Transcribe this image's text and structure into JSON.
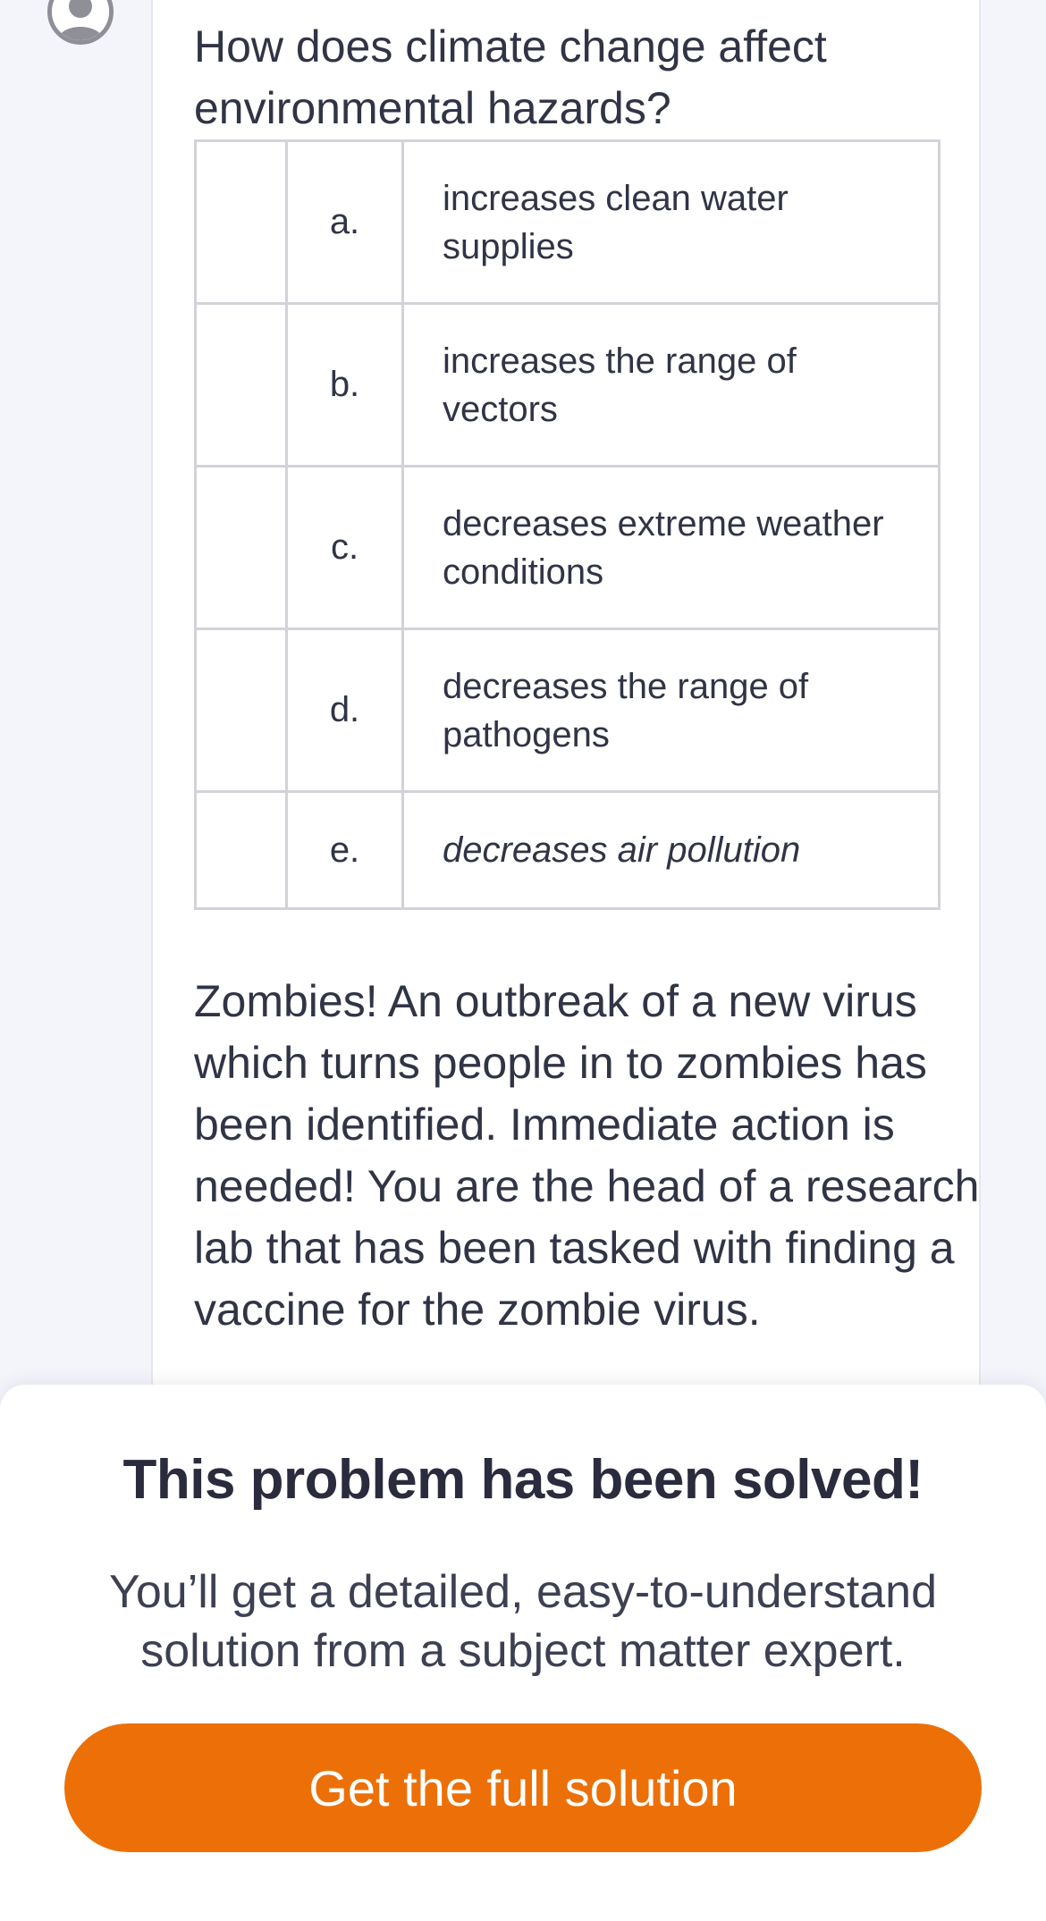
{
  "question": {
    "text": "How does climate change affect environmental hazards?",
    "options": [
      {
        "letter": "a.",
        "text": "increases clean water supplies"
      },
      {
        "letter": "b.",
        "text": "increases the range of vectors"
      },
      {
        "letter": "c.",
        "text": "decreases extreme weather conditions"
      },
      {
        "letter": "d.",
        "text": "decreases the range of pathogens"
      },
      {
        "letter": "e.",
        "text": "decreases air pollution"
      }
    ]
  },
  "scenario": {
    "text": "Zombies! An outbreak of a new virus which turns people in to zombies has been identified. Immediate action is needed! You are the head of a research lab that has been tasked with finding a vaccine for the zombie virus."
  },
  "paywall": {
    "title": "This problem has been solved!",
    "subtitle": "You’ll get a detailed, easy-to-understand solution from a subject matter expert.",
    "button_label": "Get the full solution"
  },
  "colors": {
    "accent": "#ec7007",
    "text": "#303445",
    "background": "#f4f5fb"
  },
  "icons": {
    "avatar": "user-avatar-icon"
  }
}
